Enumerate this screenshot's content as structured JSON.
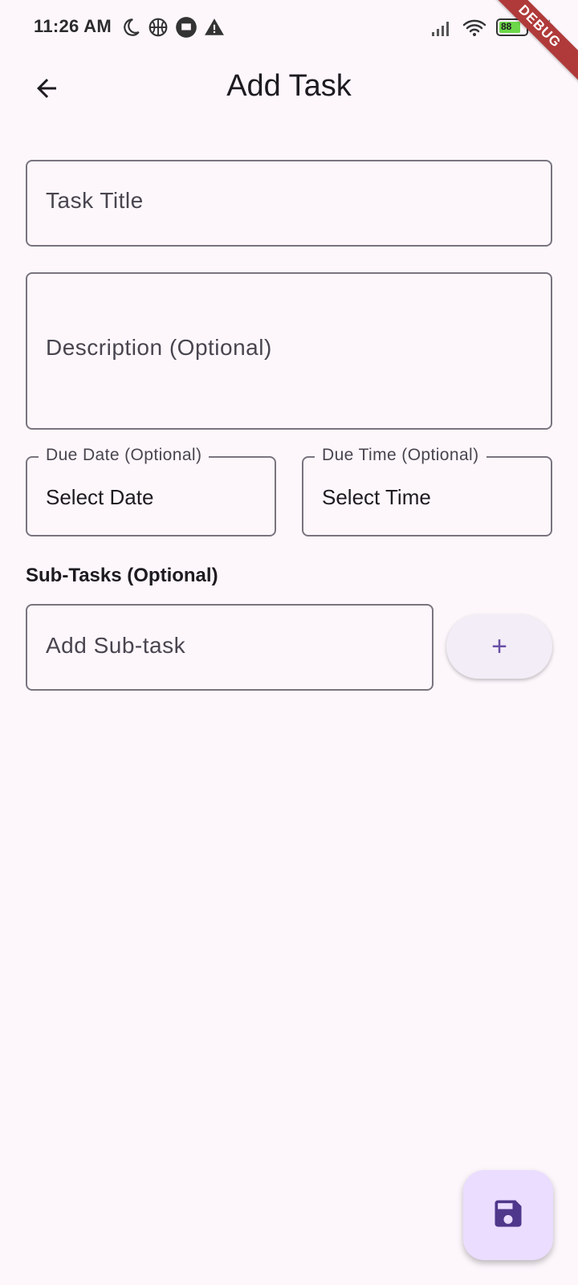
{
  "status_bar": {
    "time": "11:26 AM",
    "left_icons": [
      "moon-icon",
      "basketball-icon",
      "flag-chat-icon",
      "warning-icon"
    ],
    "right_icons": [
      "signal-icon",
      "wifi-icon",
      "battery-icon",
      "charging-icon"
    ],
    "battery_percent": "88"
  },
  "debug_banner": "DEBUG",
  "app_bar": {
    "title": "Add Task",
    "back_icon": "arrow-back-icon"
  },
  "form": {
    "task_title_placeholder": "Task Title",
    "description_placeholder": "Description (Optional)",
    "due_date": {
      "label": "Due Date (Optional)",
      "value": "Select Date"
    },
    "due_time": {
      "label": "Due Time (Optional)",
      "value": "Select Time"
    },
    "subtasks": {
      "section_label": "Sub-Tasks (Optional)",
      "input_placeholder": "Add Sub-task",
      "add_button_label": "+"
    }
  },
  "fab": {
    "icon": "save-icon"
  },
  "colors": {
    "background": "#fdf7fc",
    "primary": "#6750a4",
    "fab_container": "#eaddff",
    "fab_icon": "#4f378b",
    "outline": "#79747e",
    "debug_banner": "#b03a3a",
    "battery_fill": "#6cd84a"
  }
}
